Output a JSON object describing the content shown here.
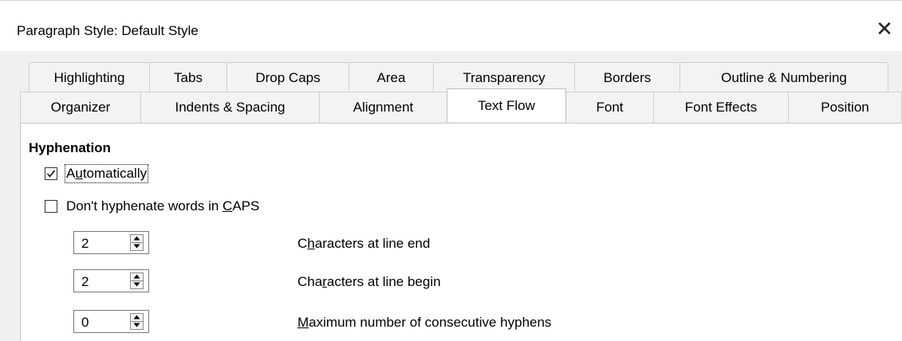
{
  "dialog": {
    "title": "Paragraph Style: Default Style",
    "close_glyph": "✕"
  },
  "tabs": {
    "row1": [
      {
        "label": "Highlighting"
      },
      {
        "label": "Tabs"
      },
      {
        "label": "Drop Caps"
      },
      {
        "label": "Area"
      },
      {
        "label": "Transparency"
      },
      {
        "label": "Borders"
      },
      {
        "label": "Outline & Numbering"
      }
    ],
    "row2": [
      {
        "label": "Organizer"
      },
      {
        "label": "Indents & Spacing"
      },
      {
        "label": "Alignment"
      },
      {
        "label": "Text Flow",
        "active": true
      },
      {
        "label": "Font"
      },
      {
        "label": "Font Effects"
      },
      {
        "label": "Position"
      }
    ]
  },
  "hyphenation": {
    "heading": "Hyphenation",
    "automatically": {
      "label_pre": "A",
      "label_mnemonic": "u",
      "label_post": "tomatically",
      "checked": true
    },
    "dont_caps": {
      "label_pre": "Don't hyphenate words in ",
      "label_mnemonic": "C",
      "label_post": "APS",
      "checked": false
    },
    "fields": [
      {
        "value": "2",
        "label_pre": "C",
        "label_mnemonic": "h",
        "label_post": "aracters at line end"
      },
      {
        "value": "2",
        "label_pre": "Cha",
        "label_mnemonic": "r",
        "label_post": "acters at line begin"
      },
      {
        "value": "0",
        "label_pre": "",
        "label_mnemonic": "M",
        "label_post": "aximum number of consecutive hyphens"
      }
    ]
  },
  "icons": {
    "close": "close-icon",
    "check": "checkmark-icon",
    "spin_up": "arrow-up-icon",
    "spin_down": "arrow-down-icon"
  }
}
